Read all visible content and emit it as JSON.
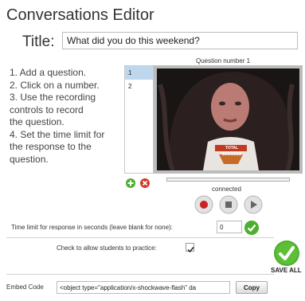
{
  "editor": {
    "heading": "Conversations Editor",
    "title_label": "Title:",
    "title_value": "What did you do this weekend?"
  },
  "instructions": [
    "1.  Add a question.",
    "2.  Click on a number.",
    "3.  Use the recording",
    "controls to record",
    "the question.",
    "4.  Set the time limit for",
    "the response to the",
    "question."
  ],
  "question_list": {
    "items": [
      "1",
      "2"
    ],
    "selected": "1"
  },
  "video": {
    "header": "Question number 1",
    "status": "connected",
    "overlay_text": "TOTAL SUCCESS"
  },
  "controls": {
    "record_icon": "record-icon",
    "stop_icon": "stop-icon",
    "play_icon": "play-icon"
  },
  "time_limit": {
    "label": "Time limit for response in seconds (leave blank for none):",
    "value": "0"
  },
  "practice": {
    "label": "Check to allow students to practice:",
    "checked": true
  },
  "save": {
    "label": "SAVE ALL"
  },
  "embed": {
    "label": "Embed Code",
    "value": "<object type=\"application/x-shockwave-flash\" da",
    "copy_label": "Copy"
  },
  "colors": {
    "accent_green": "#4caf2e",
    "remove_red": "#d23a2a",
    "record_red": "#cc2222",
    "selected_row": "#bfd7ec"
  }
}
